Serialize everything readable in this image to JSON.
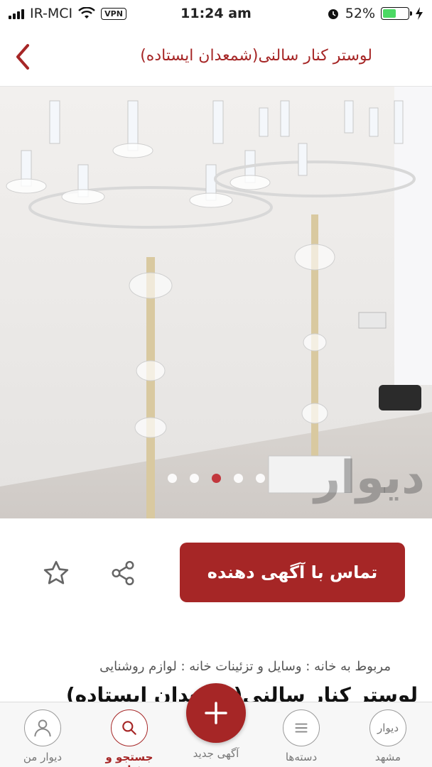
{
  "status_bar": {
    "carrier": "IR-MCI",
    "vpn": "VPN",
    "time": "11:24 am",
    "battery_percent": "52%",
    "battery_level": 0.52
  },
  "header": {
    "title": "لوستر کنار سالنی(شمعدان ایستاده)"
  },
  "gallery": {
    "image_count": 5,
    "active_index": 2,
    "watermark": "دیوار"
  },
  "actions": {
    "contact_label": "تماس با آگهی دهنده"
  },
  "listing": {
    "breadcrumb": "مربوط به خانه : وسایل و تزئینات خانه : لوازم روشنایی",
    "title": "لوستر کنار سالنی(شمعدان ایستاده)"
  },
  "bottom_nav": {
    "items": [
      {
        "label": "دیوار من",
        "icon": "user-icon"
      },
      {
        "label": "جستجو و فیلتر",
        "icon": "search-icon"
      },
      {
        "label": "آگهی جدید",
        "icon": "plus-icon"
      },
      {
        "label": "دسته‌ها",
        "icon": "menu-icon"
      },
      {
        "label": "مشهد",
        "icon": "divar-logo",
        "logo_text": "دیوار"
      }
    ],
    "active_index": 1
  },
  "colors": {
    "brand": "#a62626",
    "battery": "#4cd964"
  }
}
